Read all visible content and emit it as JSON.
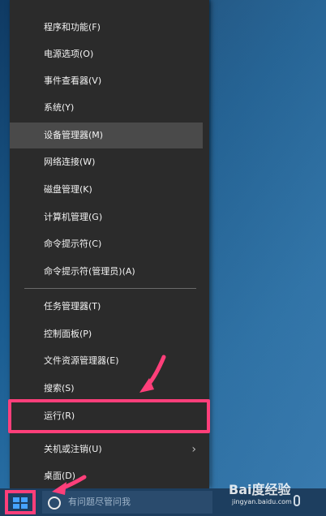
{
  "context_menu": {
    "items": [
      {
        "label": "程序和功能(F)"
      },
      {
        "label": "电源选项(O)"
      },
      {
        "label": "事件查看器(V)"
      },
      {
        "label": "系统(Y)"
      },
      {
        "label": "设备管理器(M)"
      },
      {
        "label": "网络连接(W)"
      },
      {
        "label": "磁盘管理(K)"
      },
      {
        "label": "计算机管理(G)"
      },
      {
        "label": "命令提示符(C)"
      },
      {
        "label": "命令提示符(管理员)(A)"
      },
      {
        "label": "任务管理器(T)"
      },
      {
        "label": "控制面板(P)"
      },
      {
        "label": "文件资源管理器(E)"
      },
      {
        "label": "搜索(S)"
      },
      {
        "label": "运行(R)"
      },
      {
        "label": "关机或注销(U)"
      },
      {
        "label": "桌面(D)"
      }
    ],
    "hovered_item": "设备管理器(M)",
    "submenu_icon": "chevron-right-icon"
  },
  "taskbar": {
    "start_icon": "windows-logo-icon",
    "search_placeholder": "有问题尽管问我",
    "search_icon": "cortana-circle-icon",
    "mic_icon": "microphone-icon"
  },
  "annotations": {
    "highlight_color": "#ff3f7a",
    "arrow_color": "#ff3f7a"
  },
  "watermark": {
    "logo_text": "Bai度经验",
    "url_text": "jingyan.baidu.com"
  }
}
